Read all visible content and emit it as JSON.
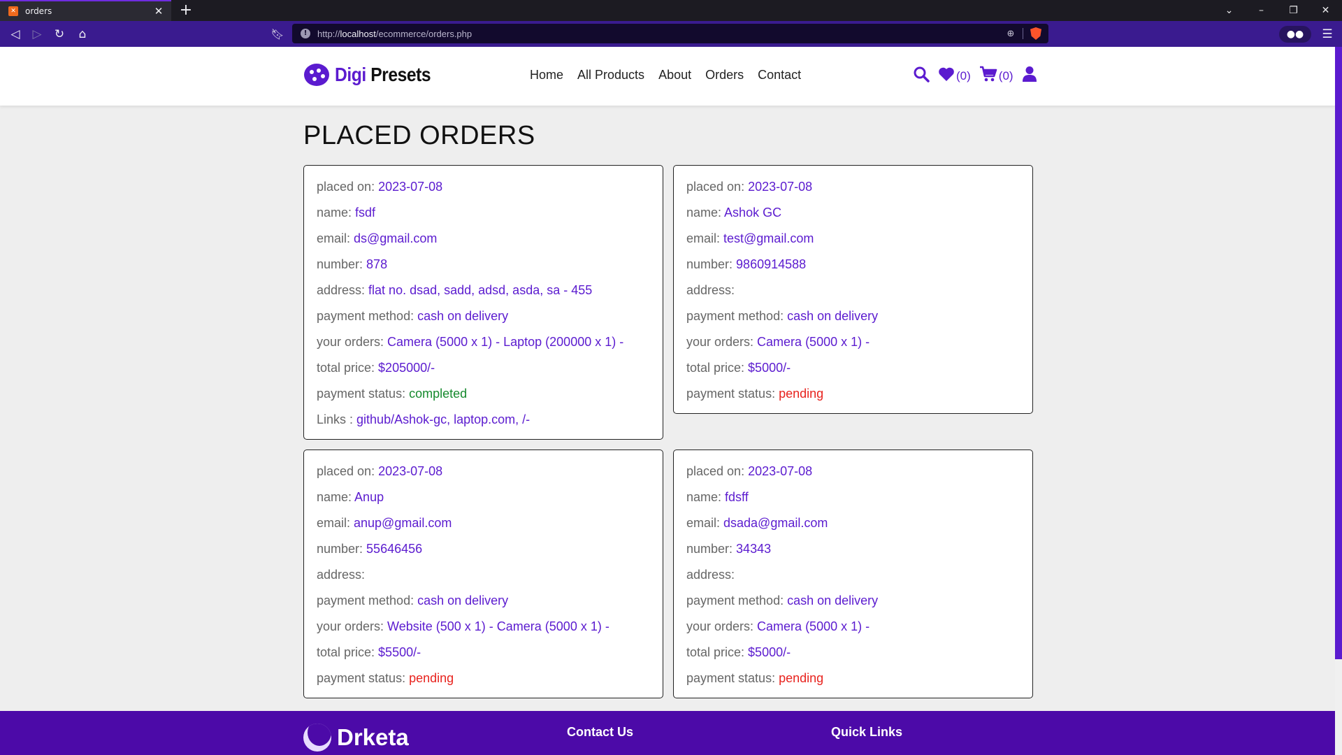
{
  "browser": {
    "tab_title": "orders",
    "url_prefix": "http://",
    "url_host": "localhost",
    "url_path": "/ecommerce/orders.php"
  },
  "site": {
    "logo_word1": "Digi",
    "logo_word2": "Presets",
    "nav": [
      "Home",
      "All Products",
      "About",
      "Orders",
      "Contact"
    ],
    "wishlist_count": "(0)",
    "cart_count": "(0)",
    "accent_color": "#5b1bcf"
  },
  "page_title": "PLACED ORDERS",
  "labels": {
    "placed_on": "placed on: ",
    "name": "name: ",
    "email": "email: ",
    "number": "number: ",
    "address": "address: ",
    "payment_method": "payment method: ",
    "your_orders": "your orders: ",
    "total_price": "total price: ",
    "payment_status": "payment status: ",
    "links": "Links : "
  },
  "orders": [
    {
      "placed_on": "2023-07-08",
      "name": "fsdf",
      "email": "ds@gmail.com",
      "number": "878",
      "address": "flat no. dsad, sadd, adsd, asda, sa - 455",
      "payment_method": "cash on delivery",
      "your_orders": "Camera (5000 x 1) - Laptop (200000 x 1) -",
      "total_price": "$205000/-",
      "payment_status": "completed",
      "links": "github/Ashok-gc, laptop.com, /-"
    },
    {
      "placed_on": "2023-07-08",
      "name": "Ashok GC",
      "email": "test@gmail.com",
      "number": "9860914588",
      "address": "",
      "payment_method": "cash on delivery",
      "your_orders": "Camera (5000 x 1) -",
      "total_price": "$5000/-",
      "payment_status": "pending"
    },
    {
      "placed_on": "2023-07-08",
      "name": "Anup",
      "email": "anup@gmail.com",
      "number": "55646456",
      "address": "",
      "payment_method": "cash on delivery",
      "your_orders": "Website (500 x 1) - Camera (5000 x 1) -",
      "total_price": "$5500/-",
      "payment_status": "pending"
    },
    {
      "placed_on": "2023-07-08",
      "name": "fdsff",
      "email": "dsada@gmail.com",
      "number": "34343",
      "address": "",
      "payment_method": "cash on delivery",
      "your_orders": "Camera (5000 x 1) -",
      "total_price": "$5000/-",
      "payment_status": "pending"
    }
  ],
  "footer": {
    "brand": "Drketa",
    "col1": "Contact Us",
    "col2": "Quick Links"
  }
}
